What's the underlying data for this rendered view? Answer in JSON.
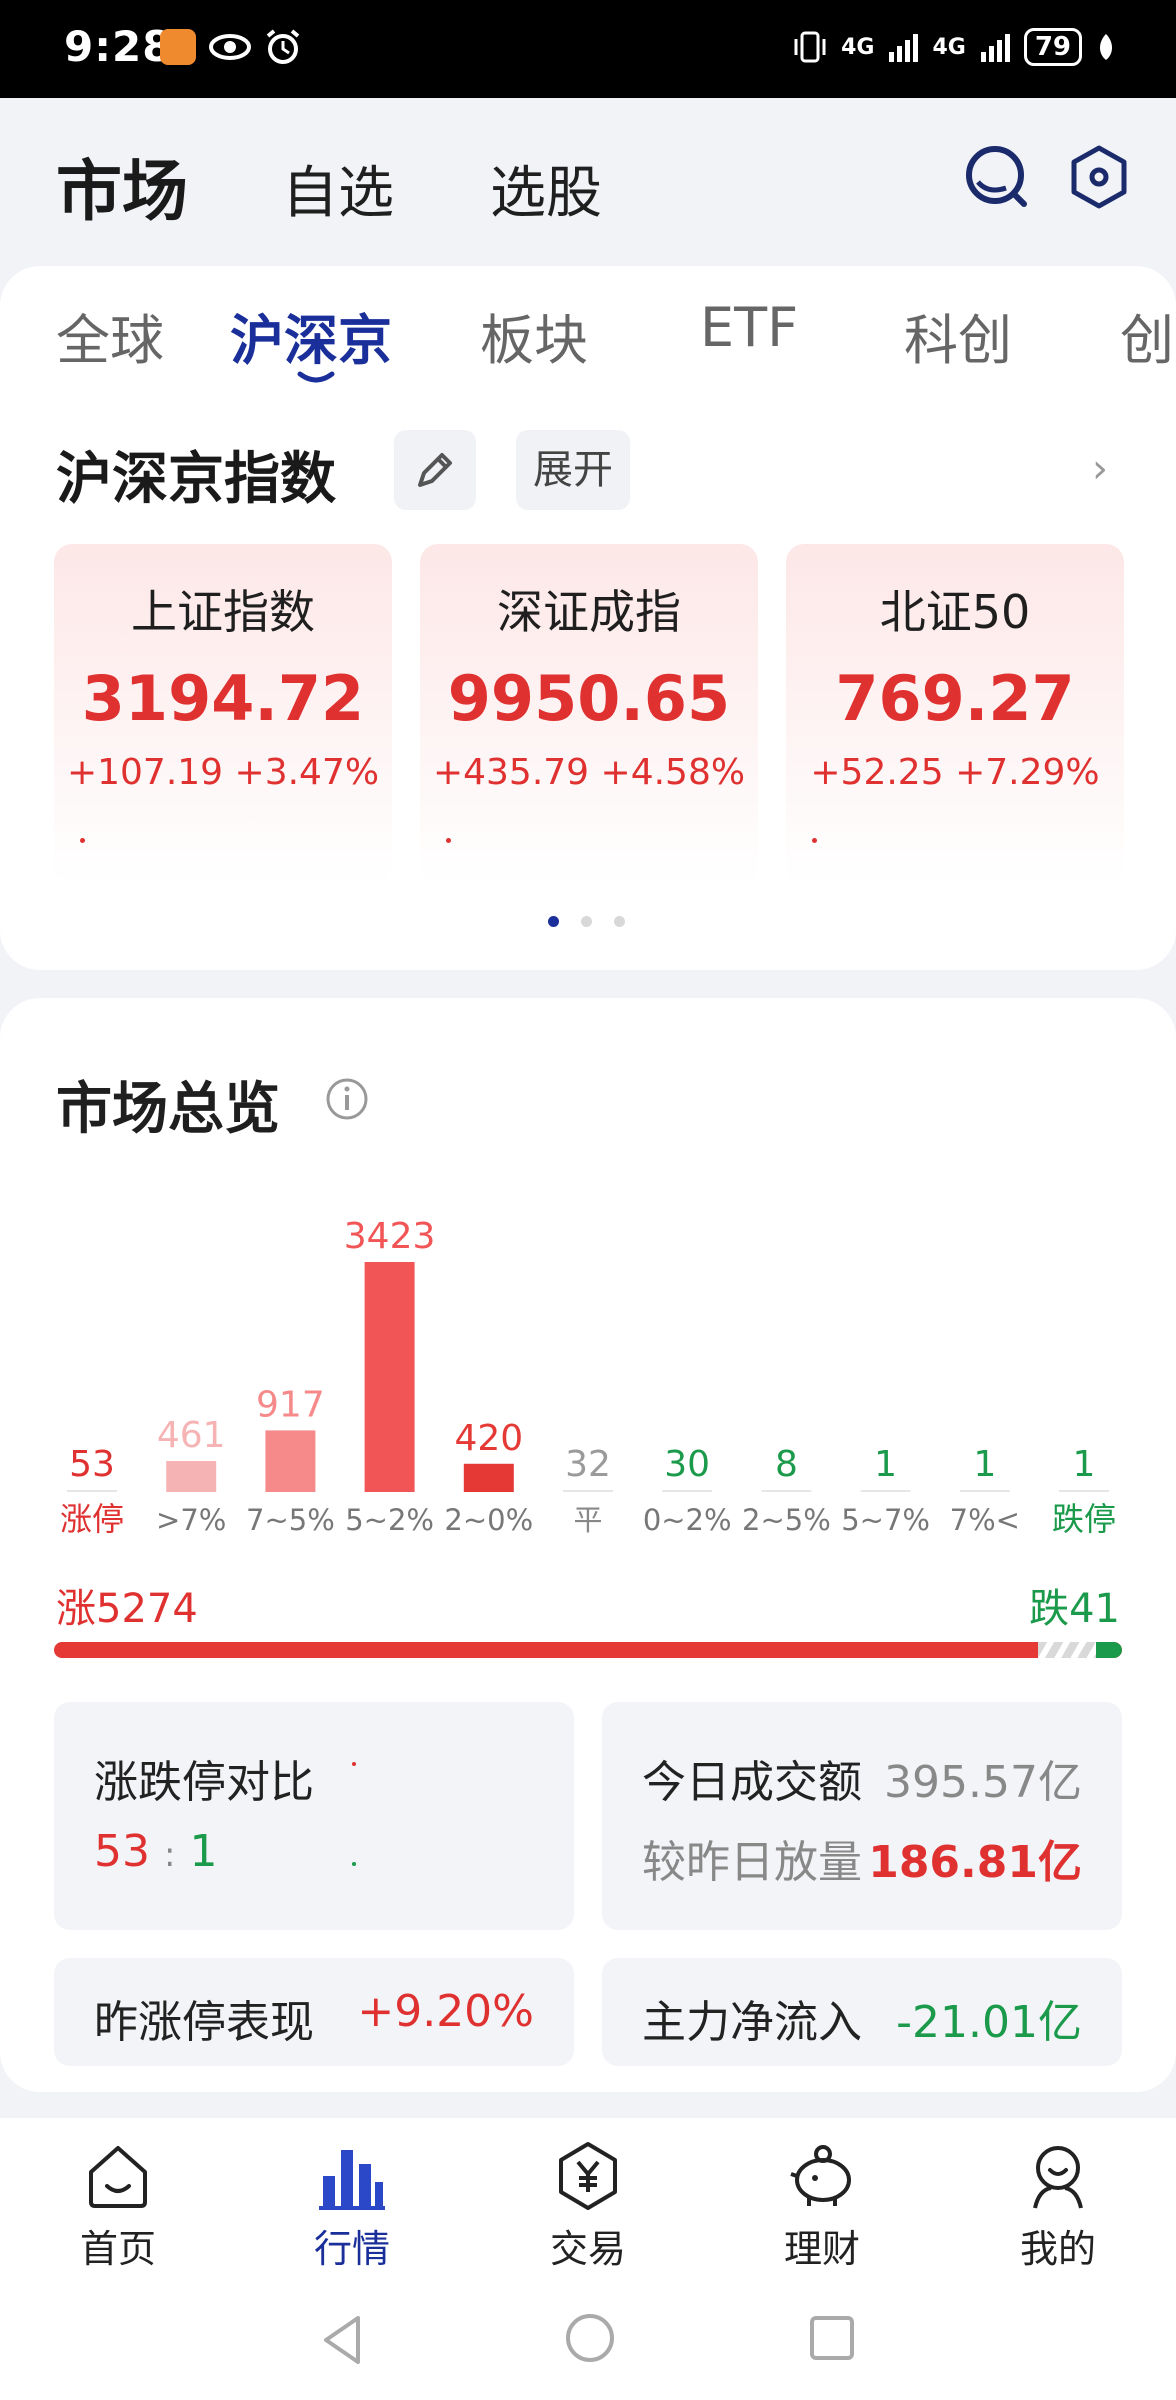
{
  "status": {
    "time": "9:28",
    "battery": "79",
    "net1": "4G",
    "net2": "4G"
  },
  "header": {
    "title": "市场",
    "nav": [
      "自选",
      "选股"
    ]
  },
  "tabs": [
    "全球",
    "沪深京",
    "板块",
    "ETF",
    "科创",
    "创"
  ],
  "active_tab": 1,
  "index_section": {
    "title": "沪深京指数",
    "expand": "展开"
  },
  "indices": [
    {
      "name": "上证指数",
      "value": "3194.72",
      "change": "+107.19",
      "pct": "+3.47%"
    },
    {
      "name": "深证成指",
      "value": "9950.65",
      "change": "+435.79",
      "pct": "+4.58%"
    },
    {
      "name": "北证50",
      "value": "769.27",
      "change": "+52.25",
      "pct": "+7.29%"
    }
  ],
  "overview": {
    "title": "市场总览",
    "up_label": "涨5274",
    "down_label": "跌41",
    "limit_compare": {
      "label": "涨跌停对比",
      "up": "53",
      "sep": ":",
      "down": "1"
    },
    "turnover": {
      "label": "今日成交额",
      "value": "395.57亿"
    },
    "vs_yesterday": {
      "label": "较昨日放量",
      "value": "186.81亿"
    },
    "yesterday_limit": {
      "label": "昨涨停表现",
      "value": "+9.20%"
    },
    "main_inflow": {
      "label": "主力净流入",
      "value": "-21.01亿"
    }
  },
  "chart_data": {
    "type": "bar",
    "categories": [
      "涨停",
      ">7%",
      "7~5%",
      "5~2%",
      "2~0%",
      "平",
      "0~2%",
      "2~5%",
      "5~7%",
      "7%<",
      "跌停"
    ],
    "values": [
      53,
      461,
      917,
      3423,
      420,
      32,
      30,
      8,
      1,
      1,
      1
    ],
    "colors": [
      "#e03131",
      "#f6b3b3",
      "#f68a8a",
      "#f25555",
      "#e53935",
      "#9a9a9a",
      "#1a9a4a",
      "#1a9a4a",
      "#1a9a4a",
      "#1a9a4a",
      "#1a9a4a"
    ]
  },
  "bottom_nav": [
    "首页",
    "行情",
    "交易",
    "理财",
    "我的"
  ],
  "bottom_active": 1
}
